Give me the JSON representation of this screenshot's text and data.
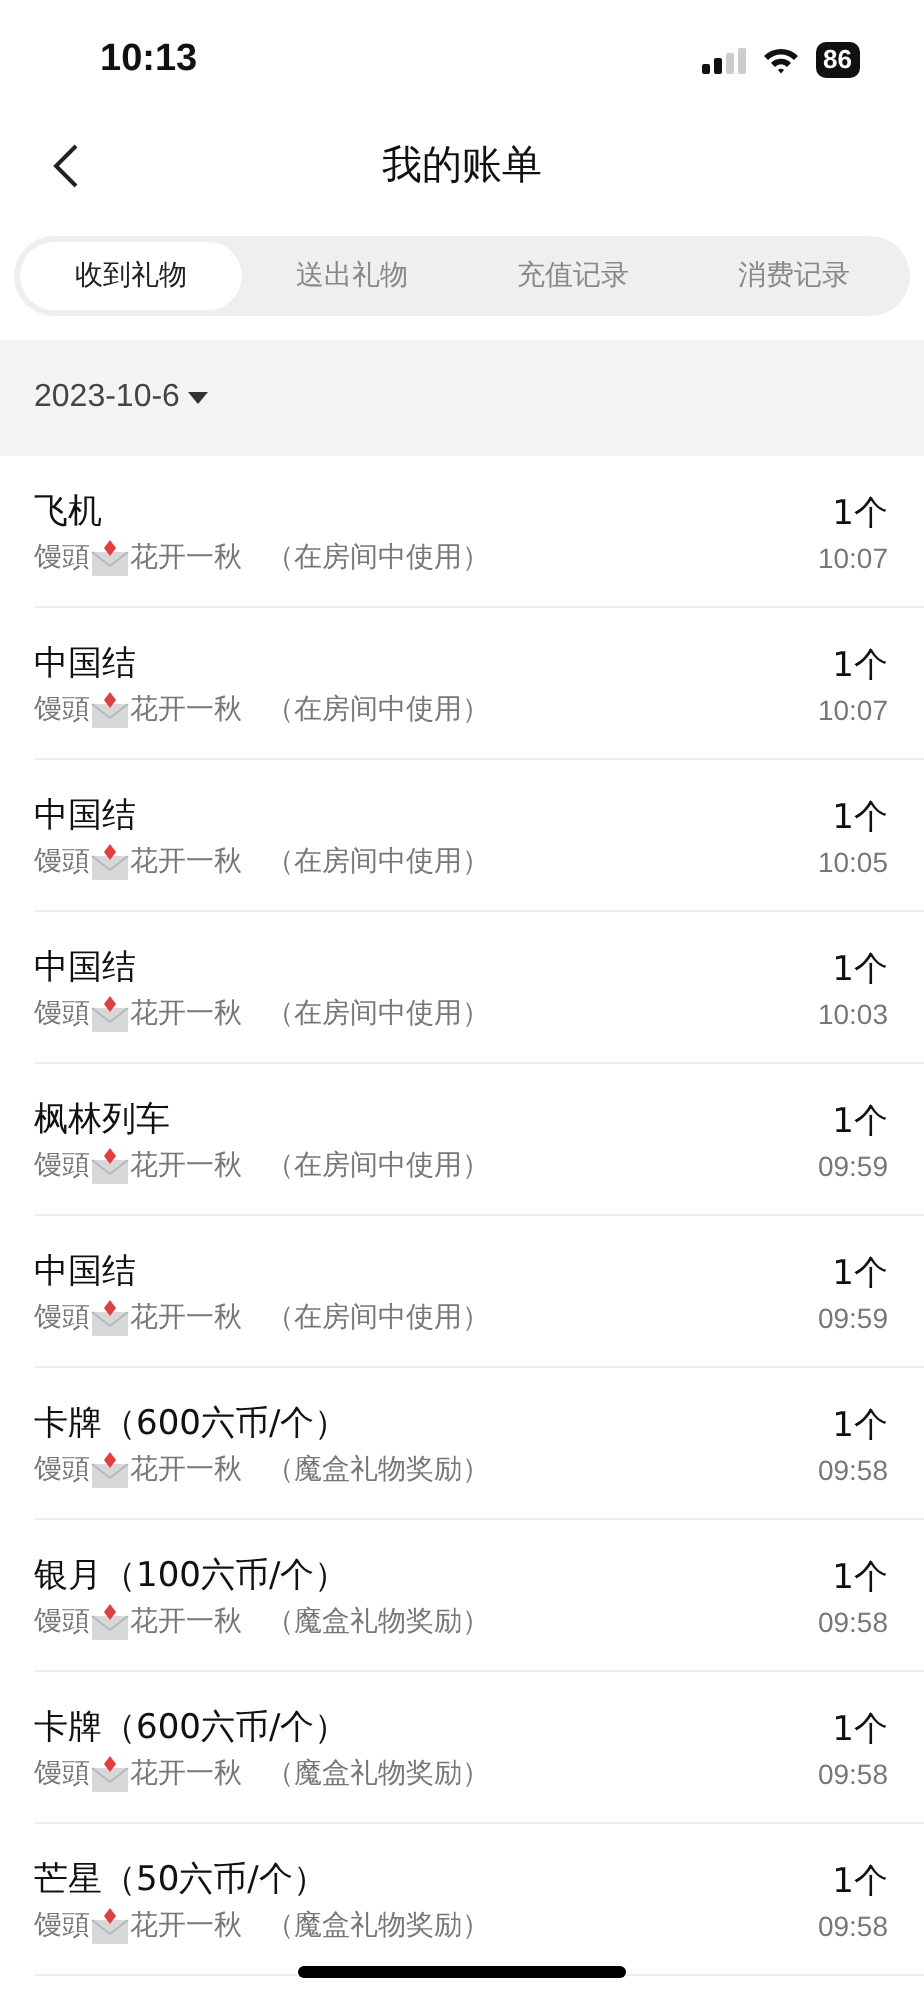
{
  "status_bar": {
    "time": "10:13",
    "battery": "86"
  },
  "nav": {
    "title": "我的账单"
  },
  "tabs": [
    {
      "label": "收到礼物",
      "selected": true
    },
    {
      "label": "送出礼物",
      "selected": false
    },
    {
      "label": "充值记录",
      "selected": false
    },
    {
      "label": "消费记录",
      "selected": false
    }
  ],
  "date_filter": {
    "label": "2023-10-6"
  },
  "records": [
    {
      "gift": "飞机",
      "sender_first": "馒頭",
      "sender_second": "花开一秋",
      "note": "（在房间中使用）",
      "count": "1个",
      "time": "10:07"
    },
    {
      "gift": "中国结",
      "sender_first": "馒頭",
      "sender_second": "花开一秋",
      "note": "（在房间中使用）",
      "count": "1个",
      "time": "10:07"
    },
    {
      "gift": "中国结",
      "sender_first": "馒頭",
      "sender_second": "花开一秋",
      "note": "（在房间中使用）",
      "count": "1个",
      "time": "10:05"
    },
    {
      "gift": "中国结",
      "sender_first": "馒頭",
      "sender_second": "花开一秋",
      "note": "（在房间中使用）",
      "count": "1个",
      "time": "10:03"
    },
    {
      "gift": "枫林列车",
      "sender_first": "馒頭",
      "sender_second": "花开一秋",
      "note": "（在房间中使用）",
      "count": "1个",
      "time": "09:59"
    },
    {
      "gift": "中国结",
      "sender_first": "馒頭",
      "sender_second": "花开一秋",
      "note": "（在房间中使用）",
      "count": "1个",
      "time": "09:59"
    },
    {
      "gift": "卡牌（600六币/个）",
      "sender_first": "馒頭",
      "sender_second": "花开一秋",
      "note": "（魔盒礼物奖励）",
      "count": "1个",
      "time": "09:58"
    },
    {
      "gift": "银月（100六币/个）",
      "sender_first": "馒頭",
      "sender_second": "花开一秋",
      "note": "（魔盒礼物奖励）",
      "count": "1个",
      "time": "09:58"
    },
    {
      "gift": "卡牌（600六币/个）",
      "sender_first": "馒頭",
      "sender_second": "花开一秋",
      "note": "（魔盒礼物奖励）",
      "count": "1个",
      "time": "09:58"
    },
    {
      "gift": "芒星（50六币/个）",
      "sender_first": "馒頭",
      "sender_second": "花开一秋",
      "note": "（魔盒礼物奖励）",
      "count": "1个",
      "time": "09:58"
    }
  ]
}
